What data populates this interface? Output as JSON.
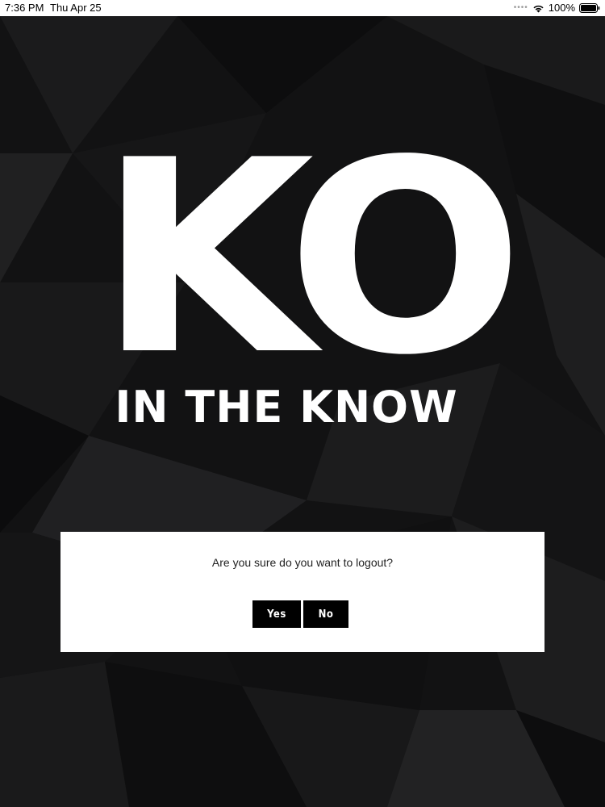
{
  "status_bar": {
    "time": "7:36 PM",
    "date": "Thu Apr 25",
    "battery": "100%",
    "icons": [
      "cellular-signal-icon",
      "wifi-icon",
      "battery-icon"
    ]
  },
  "logo": {
    "mark": "KO",
    "tagline": "IN THE KNOW"
  },
  "dialog": {
    "message": "Are you sure do you want to logout?",
    "yes_label": "Yes",
    "no_label": "No"
  },
  "colors": {
    "background": "#121213",
    "logo": "#ffffff",
    "dialog_bg": "#ffffff",
    "button_bg": "#000000",
    "button_text": "#ffffff"
  }
}
